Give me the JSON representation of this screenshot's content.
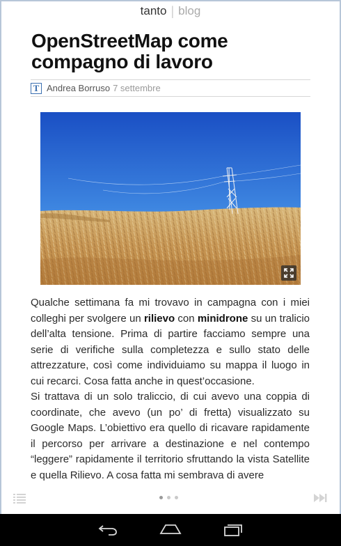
{
  "header": {
    "brand_name": "tanto",
    "separator": "|",
    "section": "blog"
  },
  "article": {
    "title": "OpenStreetMap come compagno di lavoro",
    "author": "Andrea Borruso",
    "date": "7 settembre",
    "paragraphs": [
      {
        "before": "Qualche settimana fa mi trovavo in campagna con i miei colleghi per svolgere un ",
        "bold1": "rilievo",
        "middle": " con ",
        "bold2": "minidrone",
        "after": " su un tralicio dell’alta tensione. Prima di partire facciamo sempre una serie di verifiche sulla completezza e sullo stato delle attrezzature, così come individuiamo su mappa il luogo in cui recarci. Cosa fatta anche in quest’occasione."
      },
      {
        "text": "Si trattava di un solo traliccio, di cui avevo una coppia di coordinate, che avevo (un po’ di fretta) visualizzato su Google Maps. L’obiettivo era quello di ricavare rapidamente il percorso per arrivare a destinazione e nel contempo “leggere” rapidamente il territorio sfruttando la vista Satellite e quella Rilievo. A cosa fatta mi sembrava di avere"
      }
    ]
  },
  "pager": {
    "current": 1,
    "total": 3
  },
  "icons": {
    "author_logo": "T",
    "menu": "menu-lines-icon",
    "next": "fast-forward-icon",
    "expand": "expand-icon",
    "back": "back-icon",
    "home": "home-icon",
    "recents": "recents-icon"
  },
  "colors": {
    "sky_top": "#1f56c8",
    "sky_bottom": "#7fb0ee",
    "field": "#c9a064",
    "author_logo": "#3a6fb0"
  }
}
